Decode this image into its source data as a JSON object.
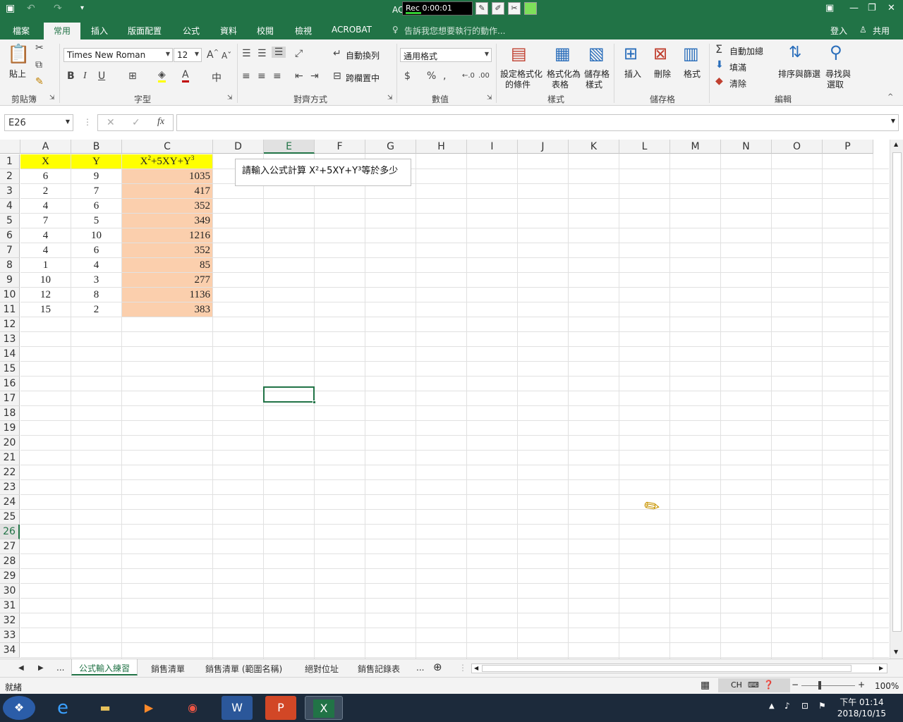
{
  "titlebar": {
    "title": "AC",
    "rec": "Rec 0:00:01"
  },
  "tabs": [
    "檔案",
    "常用",
    "插入",
    "版面配置",
    "公式",
    "資料",
    "校閱",
    "檢視",
    "ACROBAT"
  ],
  "tellme": "告訴我您想要執行的動作...",
  "signin": "登入",
  "share": "共用",
  "ribbon": {
    "paste": "貼上",
    "clipboard": "剪貼簿",
    "font_name": "Times New Roman",
    "font_size": "12",
    "font_group": "字型",
    "wrap": "自動換列",
    "merge": "跨欄置中",
    "align_group": "對齊方式",
    "number_format": "通用格式",
    "number_group": "數值",
    "cond_fmt": [
      "設定格式化",
      "的條件"
    ],
    "fmt_table": [
      "格式化為",
      "表格"
    ],
    "cell_styles": [
      "儲存格",
      "樣式"
    ],
    "styles_group": "樣式",
    "insert": "插入",
    "delete": "刪除",
    "format": "格式",
    "cells_group": "儲存格",
    "autosum": "自動加總",
    "fill": "填滿",
    "clear": "清除",
    "sort": "排序與篩選",
    "find": [
      "尋找與",
      "選取"
    ],
    "edit_group": "編輯"
  },
  "namebox": "E26",
  "columns": [
    "A",
    "B",
    "C",
    "D",
    "E",
    "F",
    "G",
    "H",
    "I",
    "J",
    "K",
    "L",
    "M",
    "N",
    "O",
    "P"
  ],
  "rows": [
    "1",
    "2",
    "3",
    "4",
    "5",
    "6",
    "7",
    "8",
    "9",
    "10",
    "11",
    "12",
    "13",
    "14",
    "15",
    "16",
    "17",
    "18",
    "19",
    "20",
    "21",
    "22",
    "23",
    "24",
    "25",
    "26",
    "27",
    "28",
    "29",
    "30",
    "31",
    "32",
    "33",
    "34"
  ],
  "table": {
    "headers": [
      "X",
      "Y"
    ],
    "formula_header": {
      "base1": "X",
      "sup1": "2",
      "mid": "+5XY+Y",
      "sup2": "3"
    },
    "data": [
      [
        "6",
        "9",
        "1035"
      ],
      [
        "2",
        "7",
        "417"
      ],
      [
        "4",
        "6",
        "352"
      ],
      [
        "7",
        "5",
        "349"
      ],
      [
        "4",
        "10",
        "1216"
      ],
      [
        "4",
        "6",
        "352"
      ],
      [
        "1",
        "4",
        "85"
      ],
      [
        "10",
        "3",
        "277"
      ],
      [
        "12",
        "8",
        "1136"
      ],
      [
        "15",
        "2",
        "383"
      ]
    ]
  },
  "textbox": "請輸入公式計算 X²+5XY+Y³等於多少",
  "sheets": [
    "公式輸入練習",
    "銷售清單",
    "銷售清單 (範圍名稱)",
    "絕對位址",
    "銷售記錄表"
  ],
  "status": {
    "ready": "就緒",
    "zoom": "100%",
    "ime": "CH"
  },
  "clock": {
    "time": "下午 01:14",
    "date": "2018/10/15"
  },
  "colors": {
    "accent": "#217346",
    "header_fill": "#ffff00",
    "result_fill": "#fbcfad"
  }
}
